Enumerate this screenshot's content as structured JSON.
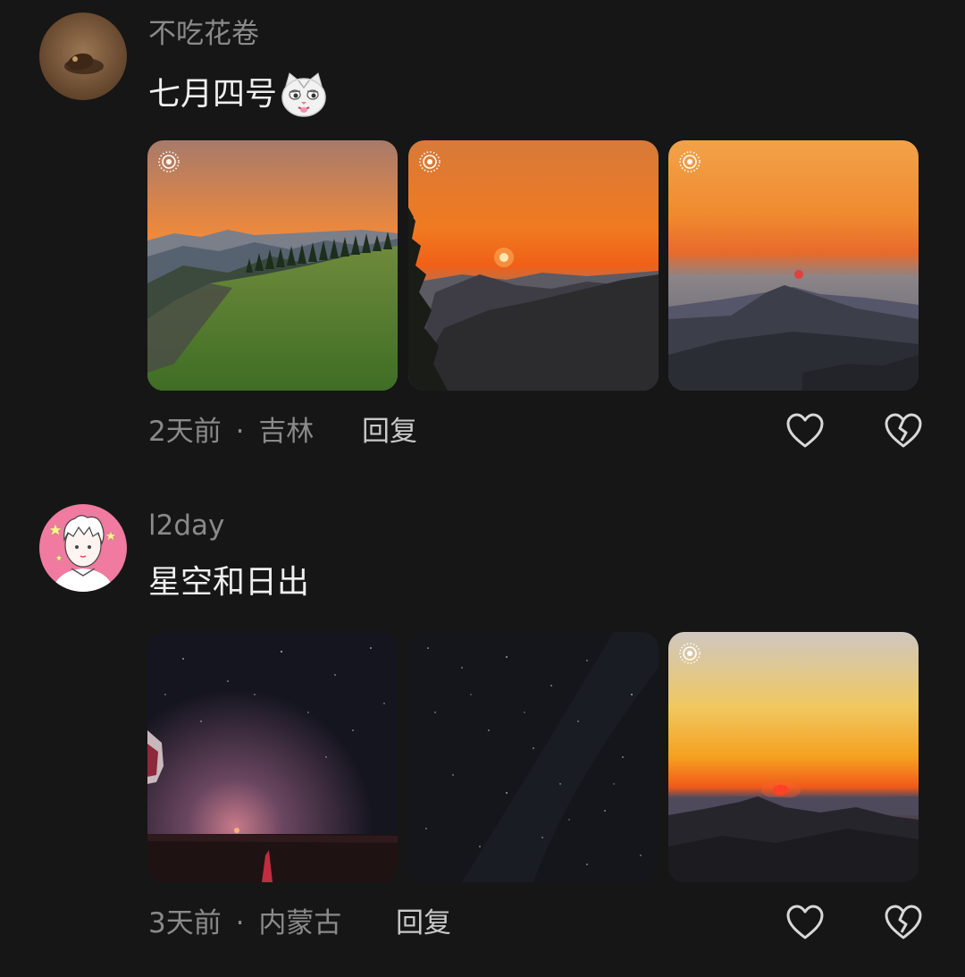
{
  "comments": [
    {
      "username": "不吃花卷",
      "text": "七月四号",
      "emoji": "smirking-cat-emoji",
      "photos": [
        {
          "scene": "sunset-grassy-ridge",
          "live": true
        },
        {
          "scene": "sunset-sun-over-mountains",
          "live": true
        },
        {
          "scene": "sunset-hazy-peaks",
          "live": true
        }
      ],
      "time": "2天前",
      "separator": "·",
      "location": "吉林",
      "reply_label": "回复"
    },
    {
      "username": "l2day",
      "text": "星空和日出",
      "photos": [
        {
          "scene": "night-horizon-glow",
          "live": false
        },
        {
          "scene": "starry-sky",
          "live": false
        },
        {
          "scene": "sunrise-over-mountains",
          "live": true
        }
      ],
      "time": "3天前",
      "separator": "·",
      "location": "内蒙古",
      "reply_label": "回复"
    }
  ],
  "icons": {
    "like": "heart-outline-icon",
    "dislike": "broken-heart-icon",
    "live": "live-photo-icon"
  },
  "colors": {
    "background": "#161616",
    "username": "#8a8a8a",
    "text": "#efefef",
    "meta": "#8a8a8a",
    "icon": "#d8d8d8"
  }
}
